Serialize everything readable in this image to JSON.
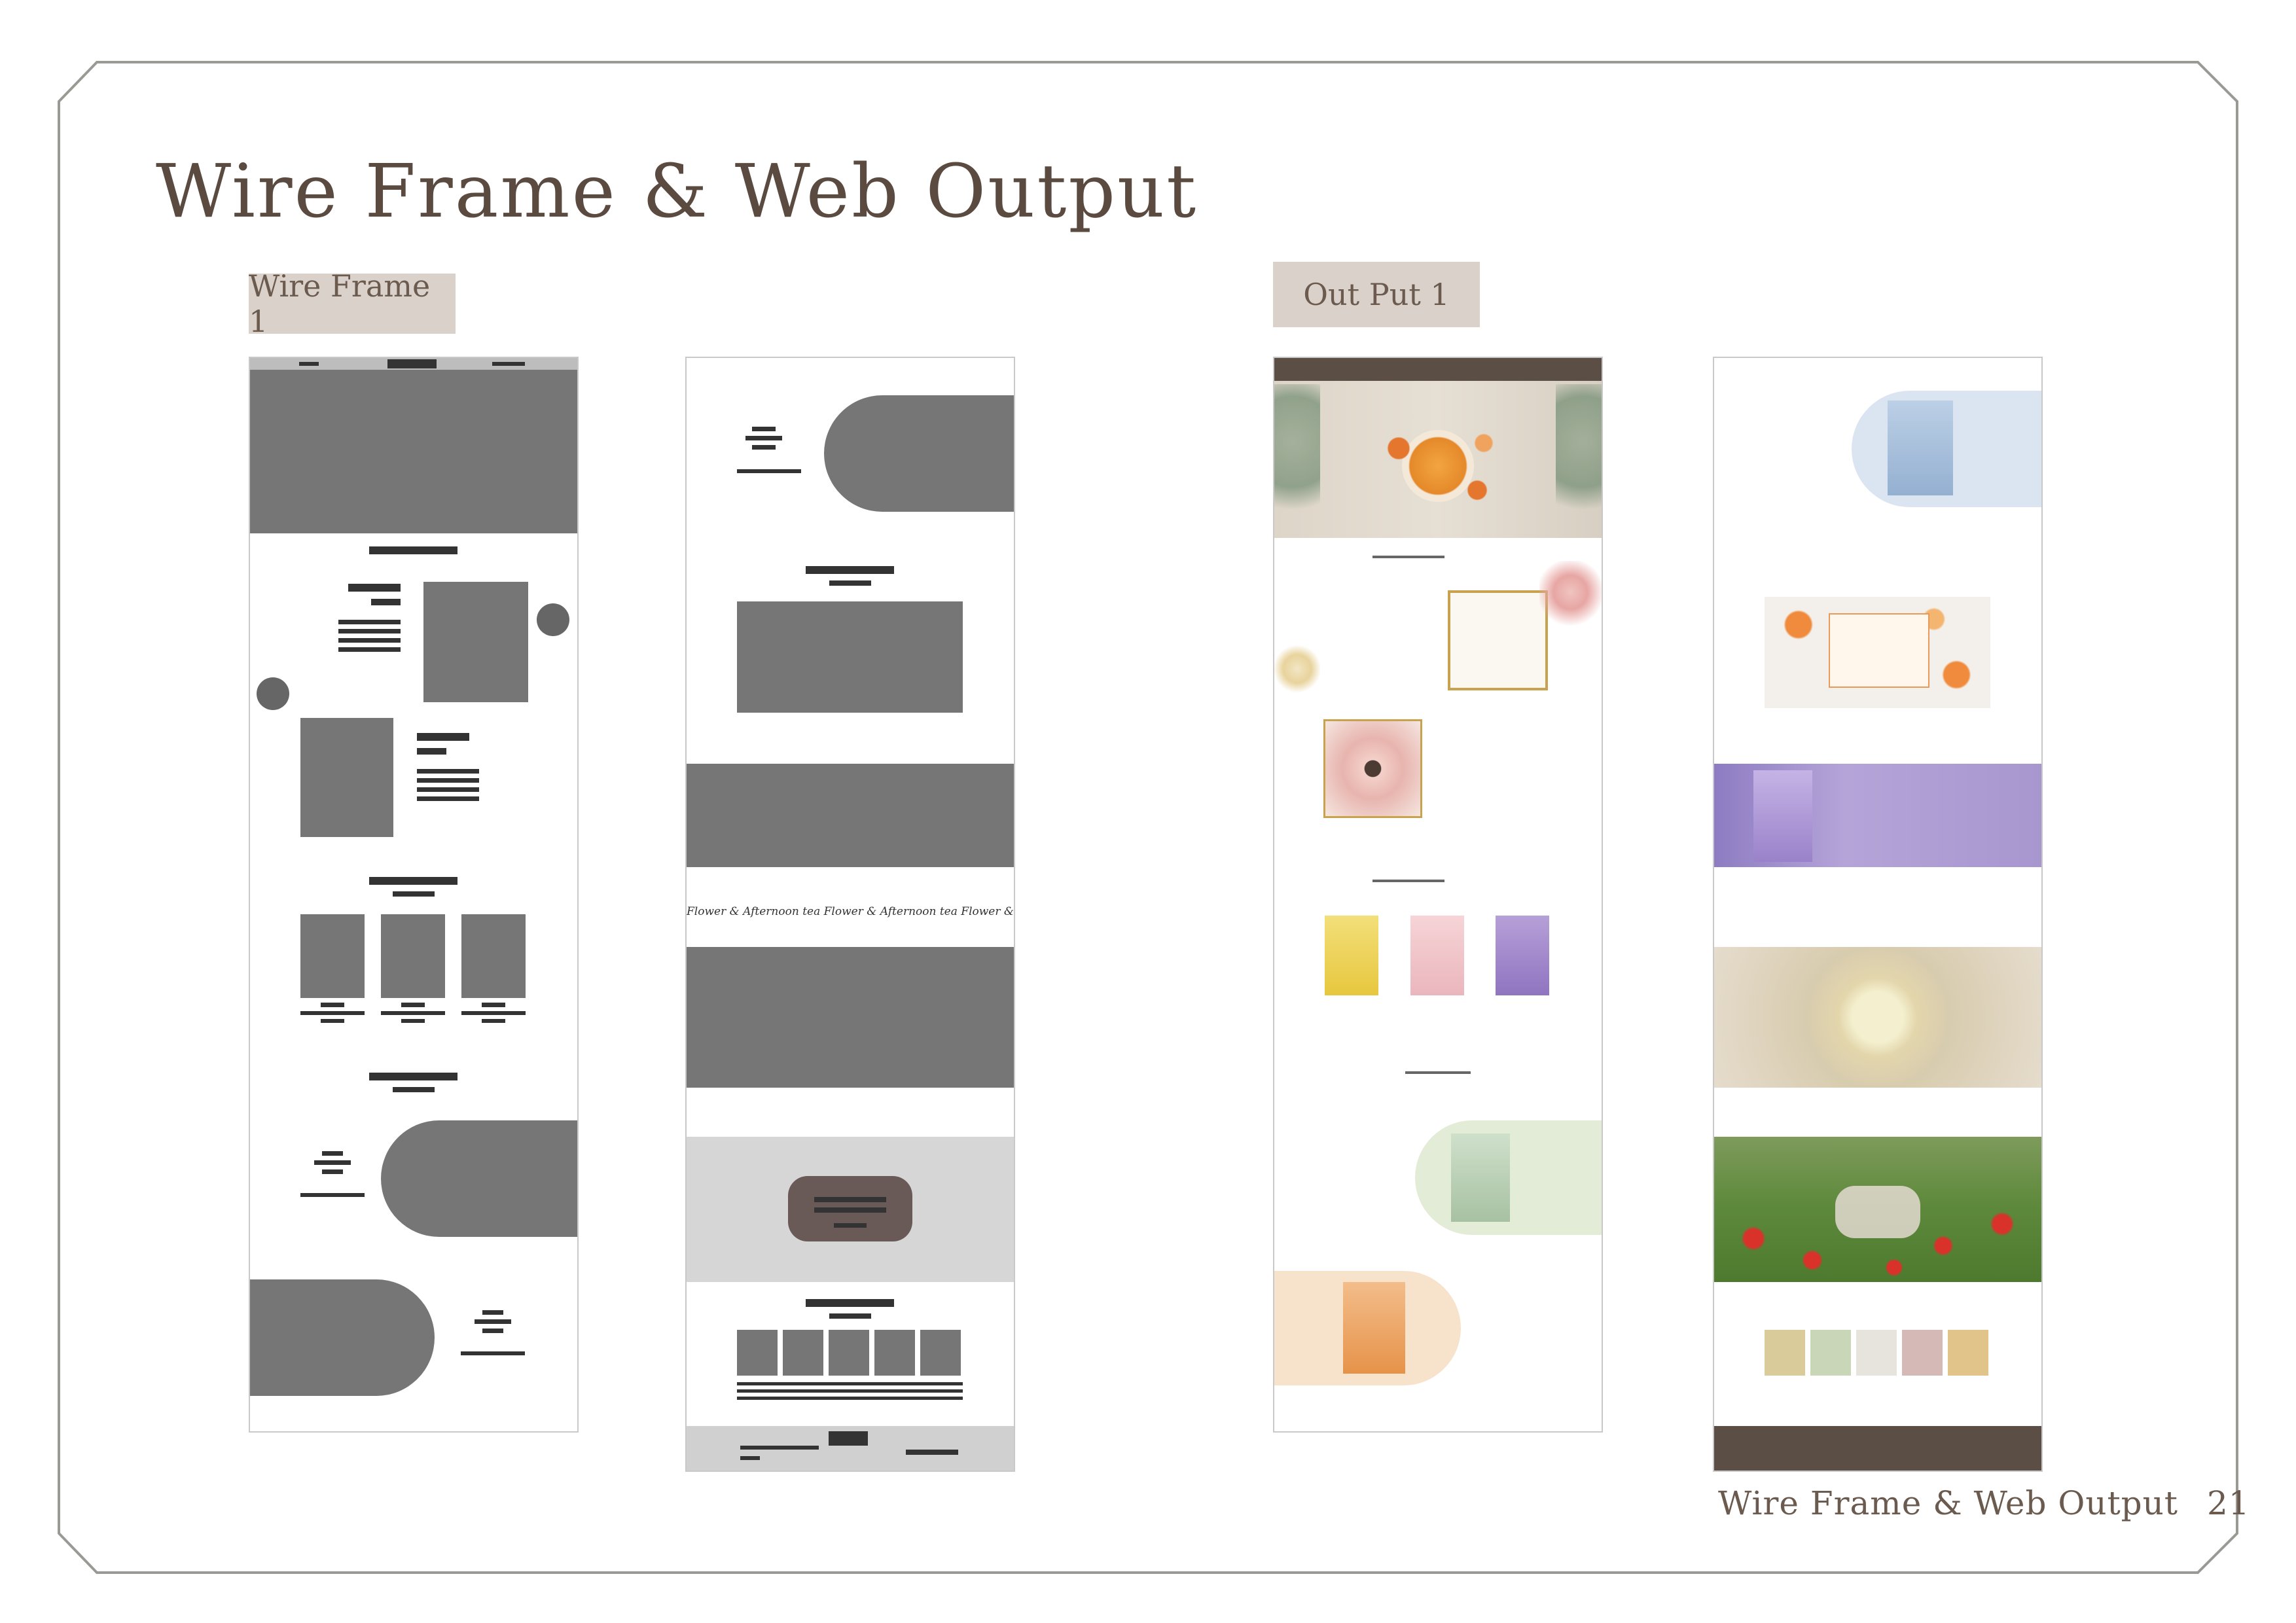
{
  "page": {
    "title": "Wire Frame & Web Output",
    "footer_label": "Wire Frame & Web Output",
    "page_number": "21"
  },
  "sections": {
    "wireframe_tag": "Wire Frame 1",
    "output_tag": "Out Put 1"
  },
  "wireframe_1": {
    "ticker_text": "Flower & Afternoon  tea Flower & Afternoon  tea Flower & Afternoon  tea Flower & Afternoon"
  },
  "colors": {
    "title": "#5a4a3f",
    "tag_bg": "#d9d1ca",
    "wire_block": "#757675",
    "wire_text": "#333333",
    "frame_line": "#9a9a94"
  }
}
